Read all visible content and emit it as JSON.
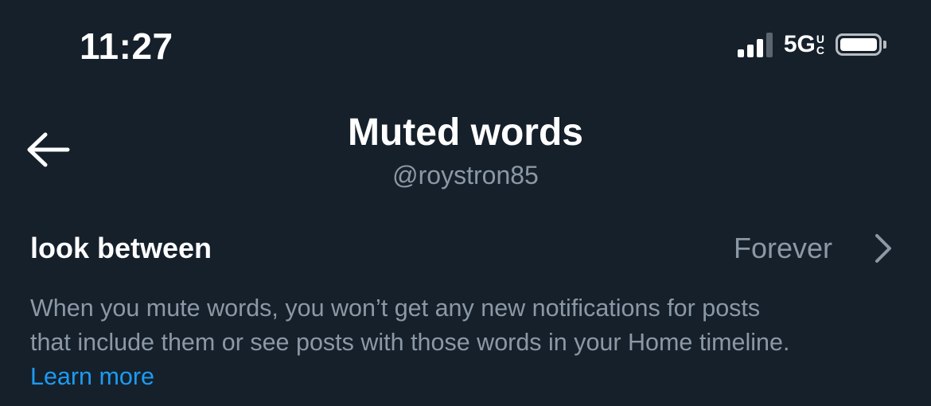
{
  "status_bar": {
    "time": "11:27",
    "network": "5G",
    "network_superscript_top": "U",
    "network_superscript_bottom": "C",
    "signal_bars_active": 3,
    "signal_bars_total": 4,
    "battery_level": 1.0
  },
  "header": {
    "back_icon": "arrow-left-icon",
    "title": "Muted words",
    "subtitle": "@roystron85"
  },
  "muted_words": [
    {
      "word": "look between",
      "duration": "Forever",
      "icon": "chevron-right-icon"
    }
  ],
  "description": {
    "line1": "When you mute words, you won’t get any new notifications for posts",
    "line2": "that include them or see posts with those words in your Home timeline.",
    "link": "Learn more"
  },
  "colors": {
    "background": "#15202b",
    "primary_text": "#ffffff",
    "secondary_text": "#8b98a5",
    "link": "#1d9bf0"
  }
}
